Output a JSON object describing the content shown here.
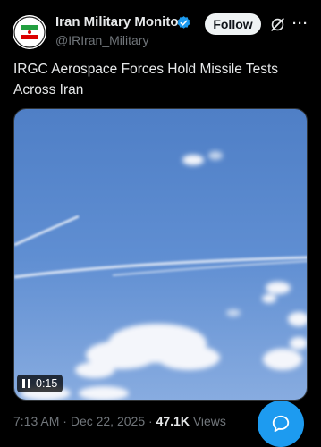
{
  "author": {
    "name": "Iran Military Monitor",
    "handle": "@IRIran_Military",
    "verified": true,
    "avatar_icon": "iran-flag-emblem-icon"
  },
  "header": {
    "follow_label": "Follow",
    "grok_icon": "grok-icon",
    "more_icon": "more-icon",
    "more_glyph": "···"
  },
  "post": {
    "text": "IRGC Aerospace Forces Hold Missile Tests Across Iran"
  },
  "video": {
    "time": "0:15",
    "state_icon": "pause-icon"
  },
  "meta": {
    "time": "7:13 AM",
    "date": "Dec 22, 2025",
    "separator": " · ",
    "views_count": "47.1K",
    "views_label": "Views"
  },
  "fab": {
    "icon": "compose-reply-icon"
  },
  "colors": {
    "background": "#000000",
    "accent": "#1d9bf0",
    "muted": "#71767b",
    "text": "#e7e9ea"
  }
}
